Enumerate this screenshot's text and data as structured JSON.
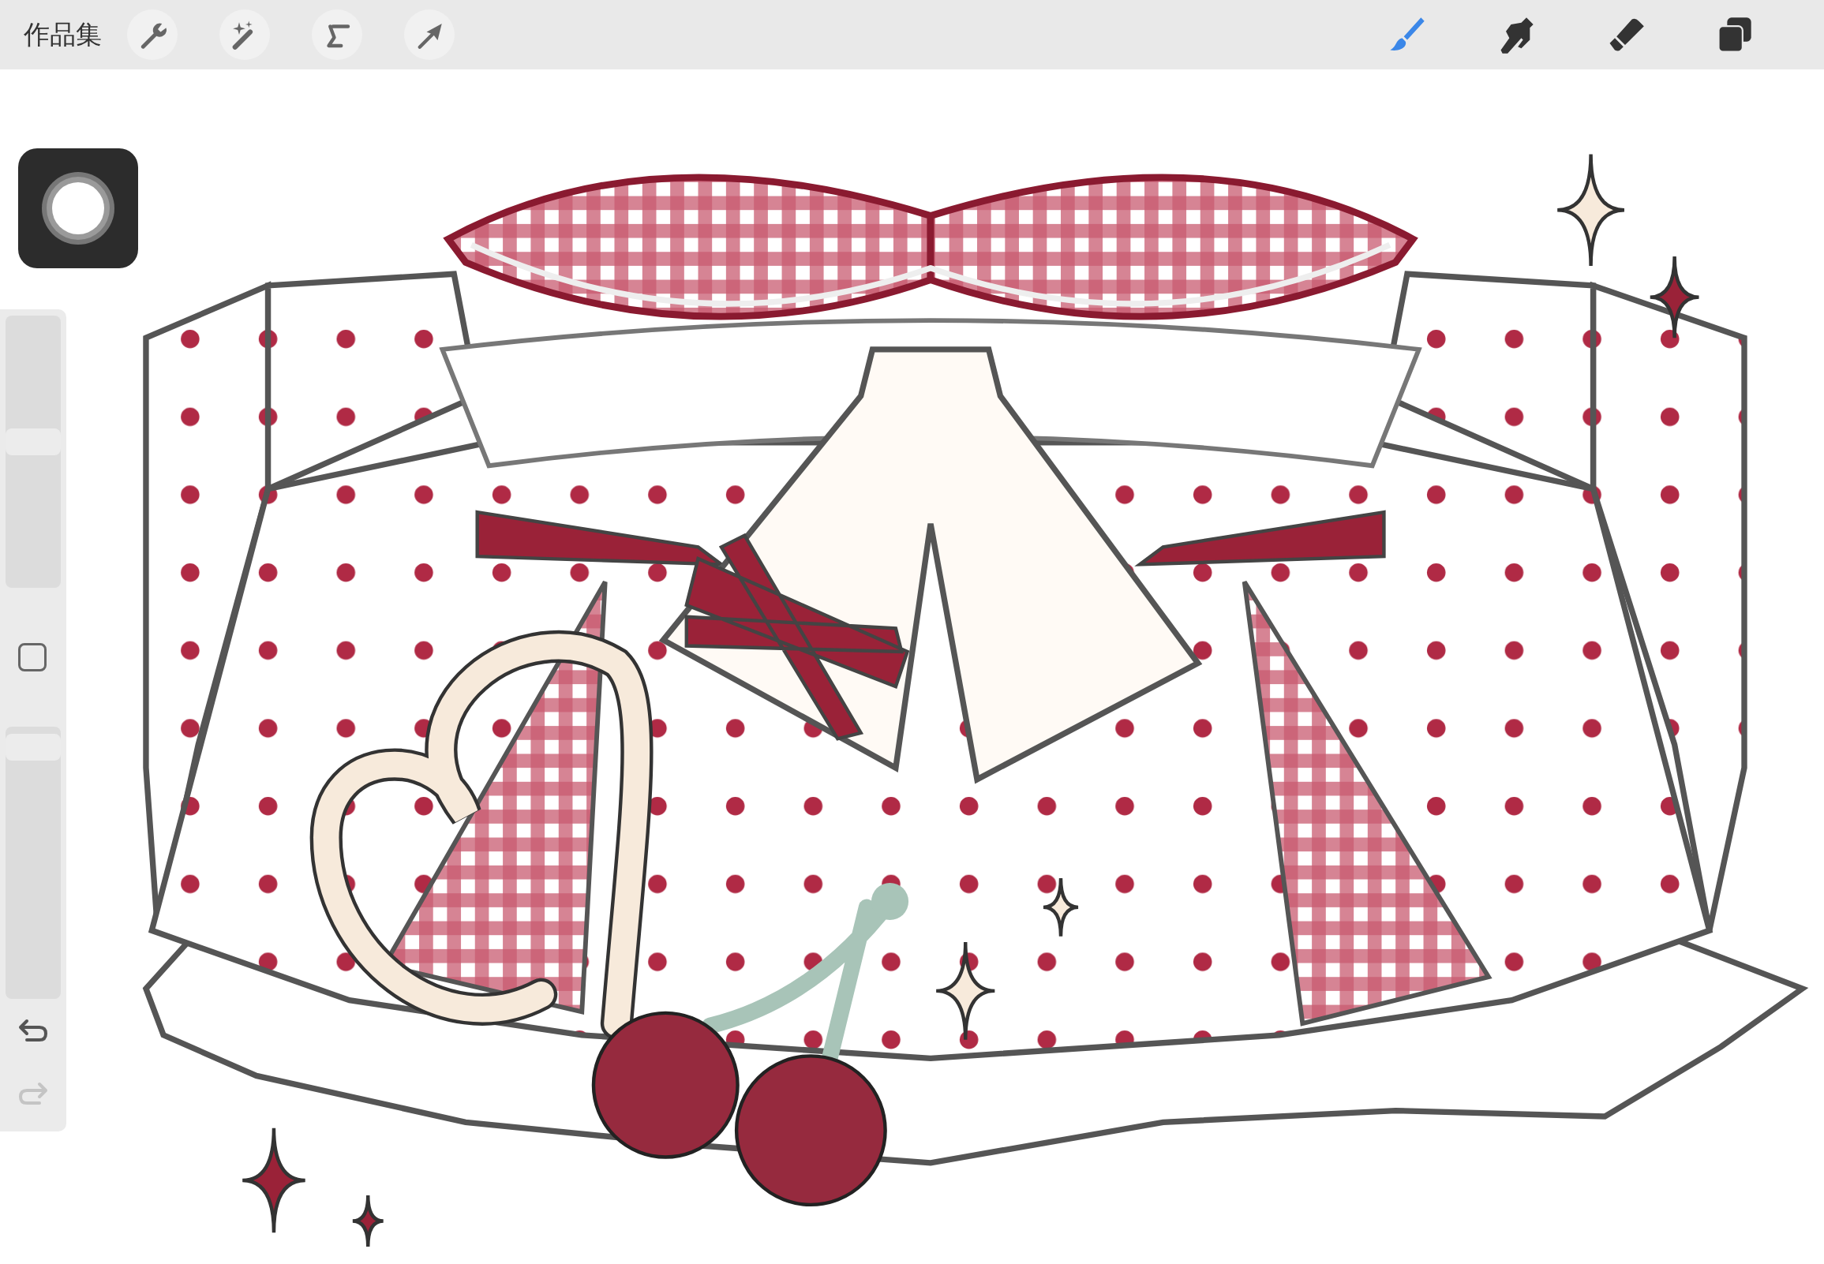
{
  "top_bar": {
    "gallery_label": "作品集",
    "actions": [
      {
        "kind": "wrench"
      },
      {
        "kind": "magic"
      },
      {
        "kind": "selection"
      },
      {
        "kind": "move"
      }
    ],
    "tools": [
      {
        "kind": "brush",
        "selected": true
      },
      {
        "kind": "smudge",
        "selected": false
      },
      {
        "kind": "eraser",
        "selected": false
      },
      {
        "kind": "layers",
        "selected": false
      }
    ]
  },
  "sidebar": {
    "size_slider": {
      "level": 0.54
    },
    "opacity_slider": {
      "level": 0.97
    },
    "undo": {
      "disabled": false
    },
    "redo": {
      "disabled": true
    }
  }
}
